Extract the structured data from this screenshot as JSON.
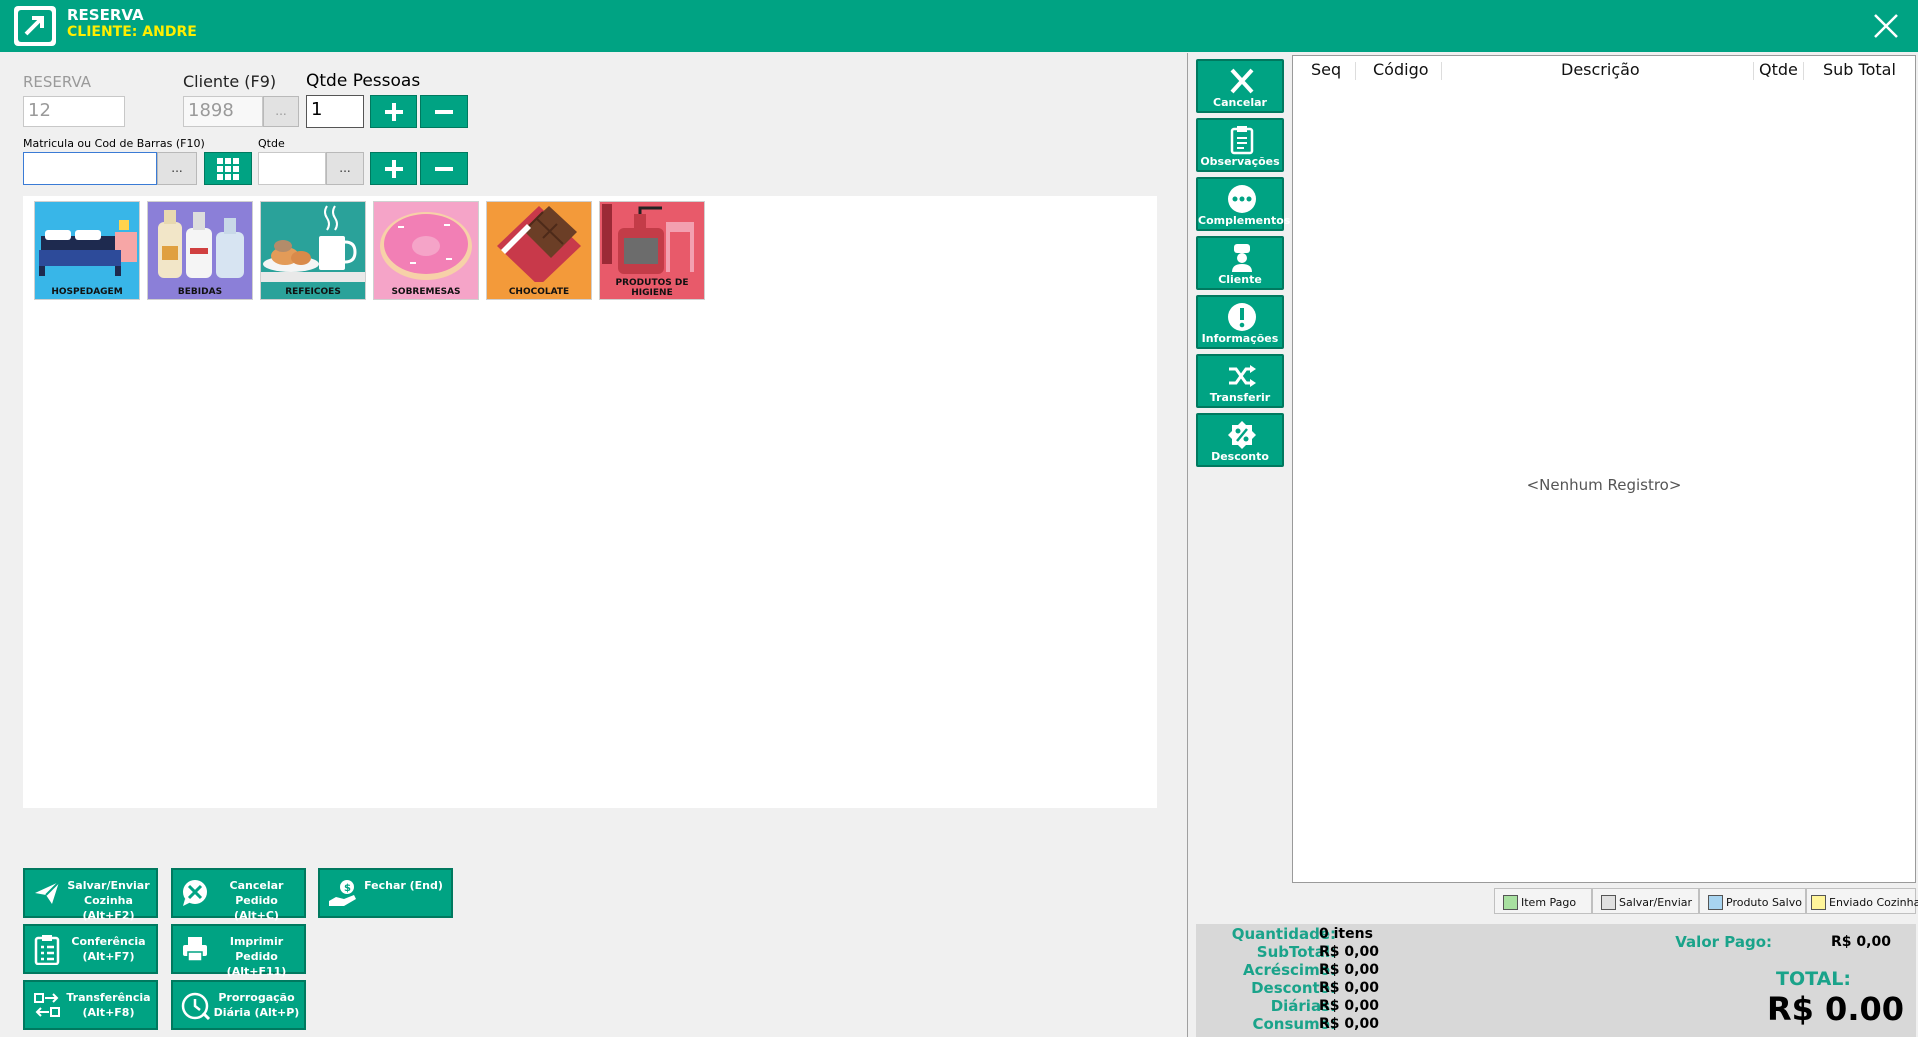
{
  "window": {
    "title": "RESERVA",
    "subtitle": "CLIENTE: ANDRE"
  },
  "form": {
    "reserva_label": "RESERVA",
    "reserva_value": "12",
    "cliente_label": "Cliente (F9)",
    "cliente_value": "1898",
    "pessoas_label": "Qtde Pessoas",
    "pessoas_value": "1",
    "matricula_label": "Matricula ou Cod de Barras (F10)",
    "matricula_value": "",
    "qtde_label": "Qtde",
    "qtde_value": "",
    "ellipsis": "..."
  },
  "categories": [
    {
      "label": "HOSPEDAGEM",
      "bg": "#38b6e8"
    },
    {
      "label": "BEBIDAS",
      "bg": "#8b7fd8"
    },
    {
      "label": "REFEICOES",
      "bg": "#2aa29a"
    },
    {
      "label": "SOBREMESAS",
      "bg": "#f5a4c8"
    },
    {
      "label": "CHOCOLATE",
      "bg": "#f39a3a"
    },
    {
      "label": "PRODUTOS DE HIGIENE",
      "bg": "#e85a6a"
    }
  ],
  "side_buttons": [
    {
      "label": "Cancelar",
      "icon": "close-icon"
    },
    {
      "label": "Observações",
      "icon": "clipboard-icon"
    },
    {
      "label": "Complementos",
      "icon": "more-dots-icon"
    },
    {
      "label": "Cliente",
      "icon": "user-icon"
    },
    {
      "label": "Informações",
      "icon": "info-icon"
    },
    {
      "label": "Transferir",
      "icon": "shuffle-icon"
    },
    {
      "label": "Desconto",
      "icon": "percent-badge-icon"
    }
  ],
  "grid": {
    "columns": [
      "Seq",
      "Código",
      "Descrição",
      "Qtde",
      "Sub Total"
    ],
    "empty_text": "<Nenhum Registro>"
  },
  "legend": [
    {
      "label": "Item Pago",
      "color": "#a8e0a0"
    },
    {
      "label": "Salvar/Enviar",
      "color": "#e0e0e0"
    },
    {
      "label": "Produto Salvo",
      "color": "#a8d4f0"
    },
    {
      "label": "Enviado Cozinha",
      "color": "#fff59a"
    }
  ],
  "actions": [
    {
      "label": "Salvar/Enviar Cozinha (Alt+F2)",
      "icon": "send-icon"
    },
    {
      "label": "Cancelar Pedido (Alt+C)",
      "icon": "cancel-chat-icon"
    },
    {
      "label": "Fechar (End)",
      "icon": "hand-money-icon"
    },
    {
      "label": "Conferência (Alt+F7)",
      "icon": "checklist-icon"
    },
    {
      "label": "Imprimir Pedido (Alt+F11)",
      "icon": "printer-icon"
    },
    {
      "label": "Transferência (Alt+F8)",
      "icon": "transfer-icon"
    },
    {
      "label": "Prorrogação Diária (Alt+P)",
      "icon": "clock-extend-icon"
    }
  ],
  "totals": {
    "quantidade_label": "Quantidade:",
    "quantidade_value": "0 itens",
    "subtotal_label": "SubTotal:",
    "subtotal_value": "R$ 0,00",
    "acrescimo_label": "Acréscimo:",
    "acrescimo_value": "R$ 0,00",
    "desconto_label": "Desconto:",
    "desconto_value": "R$ 0,00",
    "diarias_label": "Diárias:",
    "diarias_value": "R$ 0,00",
    "consumo_label": "Consumo:",
    "consumo_value": "R$ 0,00",
    "valor_pago_label": "Valor Pago:",
    "valor_pago_value": "R$ 0,00",
    "total_label": "TOTAL:",
    "total_value": "R$ 0.00"
  }
}
